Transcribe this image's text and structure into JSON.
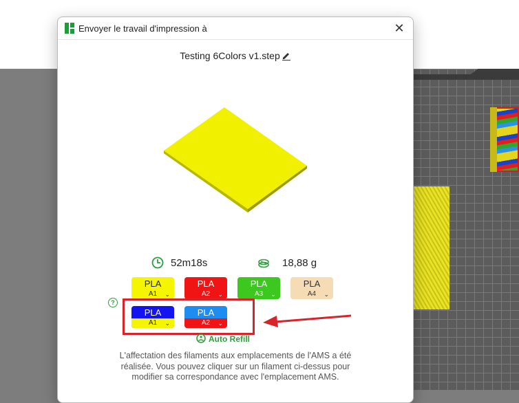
{
  "dialog": {
    "title": "Envoyer le travail d'impression à",
    "close_glyph": "✕",
    "job_name": "Testing 6Colors v1.step",
    "print_time": "52m18s",
    "filament_weight": "18,88 g",
    "filaments_row1": [
      {
        "type": "PLA",
        "slot": "A1",
        "color": "#f5f500",
        "slot_color": "#f5f500",
        "text_color": "#222222"
      },
      {
        "type": "PLA",
        "slot": "A2",
        "color": "#f01414",
        "slot_color": "#f01414",
        "text_color": "#ffffff"
      },
      {
        "type": "PLA",
        "slot": "A3",
        "color": "#3cc81e",
        "slot_color": "#3cc81e",
        "text_color": "#ffffff"
      },
      {
        "type": "PLA",
        "slot": "A4",
        "color": "#f5dcb4",
        "slot_color": "#f5dcb4",
        "text_color": "#333333"
      }
    ],
    "filaments_row2": [
      {
        "type": "PLA",
        "slot": "A1",
        "color": "#1414f0",
        "slot_color": "#f5f500",
        "text_color": "#ffffff",
        "slot_text_color": "#222222"
      },
      {
        "type": "PLA",
        "slot": "A2",
        "color": "#1e8cf0",
        "slot_color": "#f01414",
        "text_color": "#ffffff",
        "slot_text_color": "#ffffff"
      }
    ],
    "chevron": "⌄",
    "help_glyph": "?",
    "auto_refill": "Auto Refill",
    "info_text": "L'affectation des filaments aux emplacements de l'AMS a été réalisée. Vous pouvez cliquer sur un filament ci-dessus pour modifier sa correspondance avec l'emplacement AMS.",
    "accent_color": "#2e9e3d",
    "highlight_color": "#d6242a",
    "model_color": "#f0f000"
  }
}
